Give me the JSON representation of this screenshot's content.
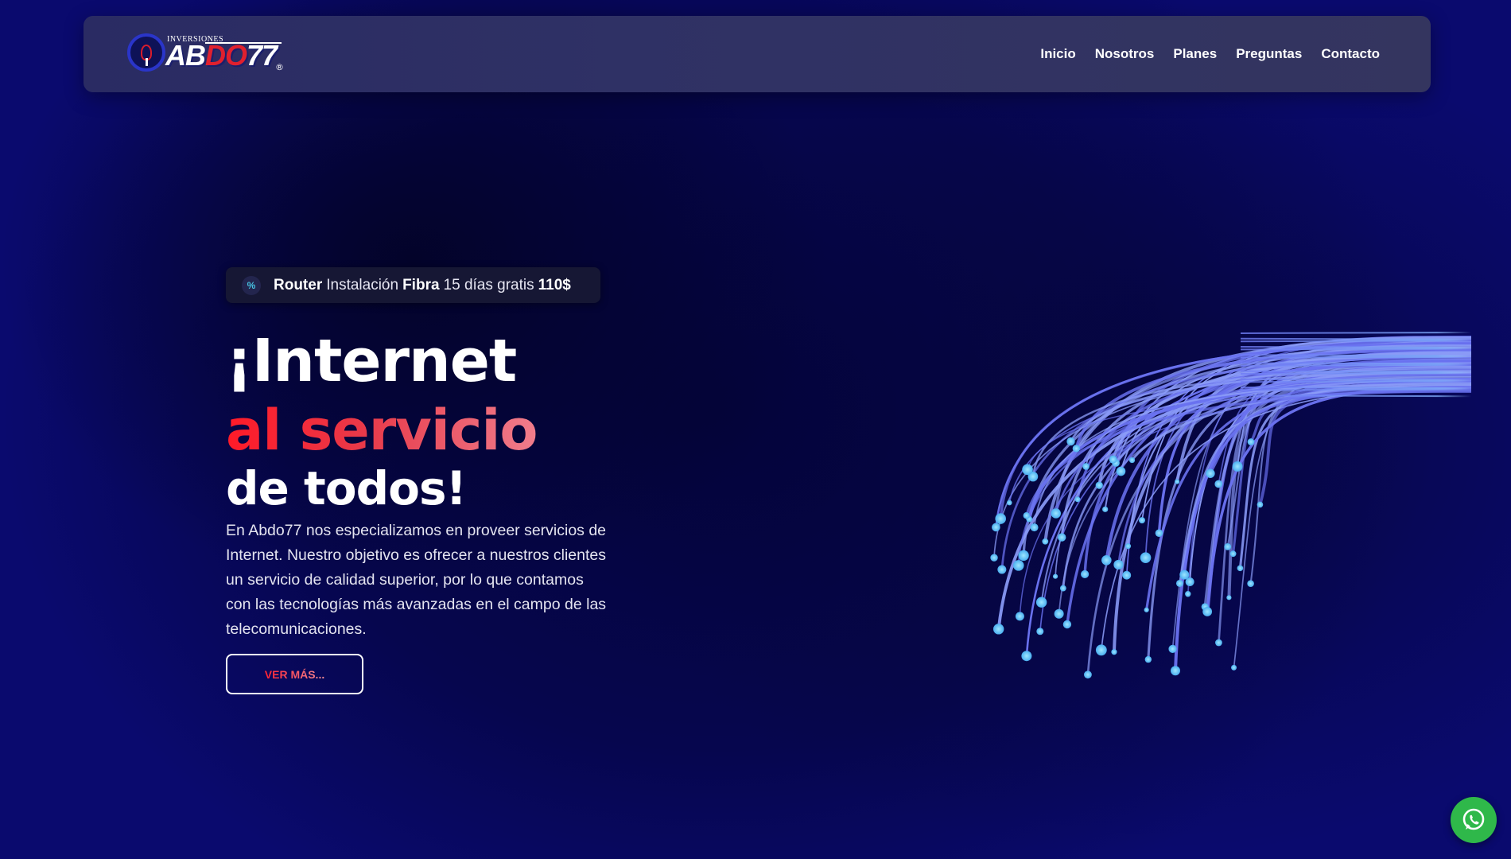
{
  "brand": {
    "logo_top": "INVERSIONES",
    "logo_part1": "AB",
    "logo_part2": "DO",
    "logo_part3": "77",
    "logo_reg": "®",
    "colors": {
      "blue": "#2a35c9",
      "red": "#e0202e"
    }
  },
  "nav": {
    "items": [
      {
        "label": "Inicio"
      },
      {
        "label": "Nosotros"
      },
      {
        "label": "Planes"
      },
      {
        "label": "Preguntas"
      },
      {
        "label": "Contacto"
      }
    ]
  },
  "promo": {
    "icon": "percent-icon",
    "icon_glyph": "%",
    "parts": [
      "Router",
      "Instalación",
      "Fibra",
      "15 días gratis",
      "110$"
    ]
  },
  "hero": {
    "line1": "¡Internet",
    "line2": "al servicio",
    "line3": "de todos!",
    "description": "En Abdo77 nos especializamos en proveer servicios de Internet. Nuestro objetivo es ofrecer a nuestros clientes un servicio de calidad superior, por lo que contamos con las tecnologías más avanzadas en el campo de las telecomunicaciones.",
    "cta_label": "VER MÁS..."
  },
  "floating": {
    "whatsapp_icon": "whatsapp-icon",
    "color": "#2fb84a"
  },
  "theme": {
    "background": "#06064e",
    "accent_red": "#ff1a28",
    "fiber_blue": "#5a6cf0",
    "fiber_tip": "#5ec8f5"
  }
}
